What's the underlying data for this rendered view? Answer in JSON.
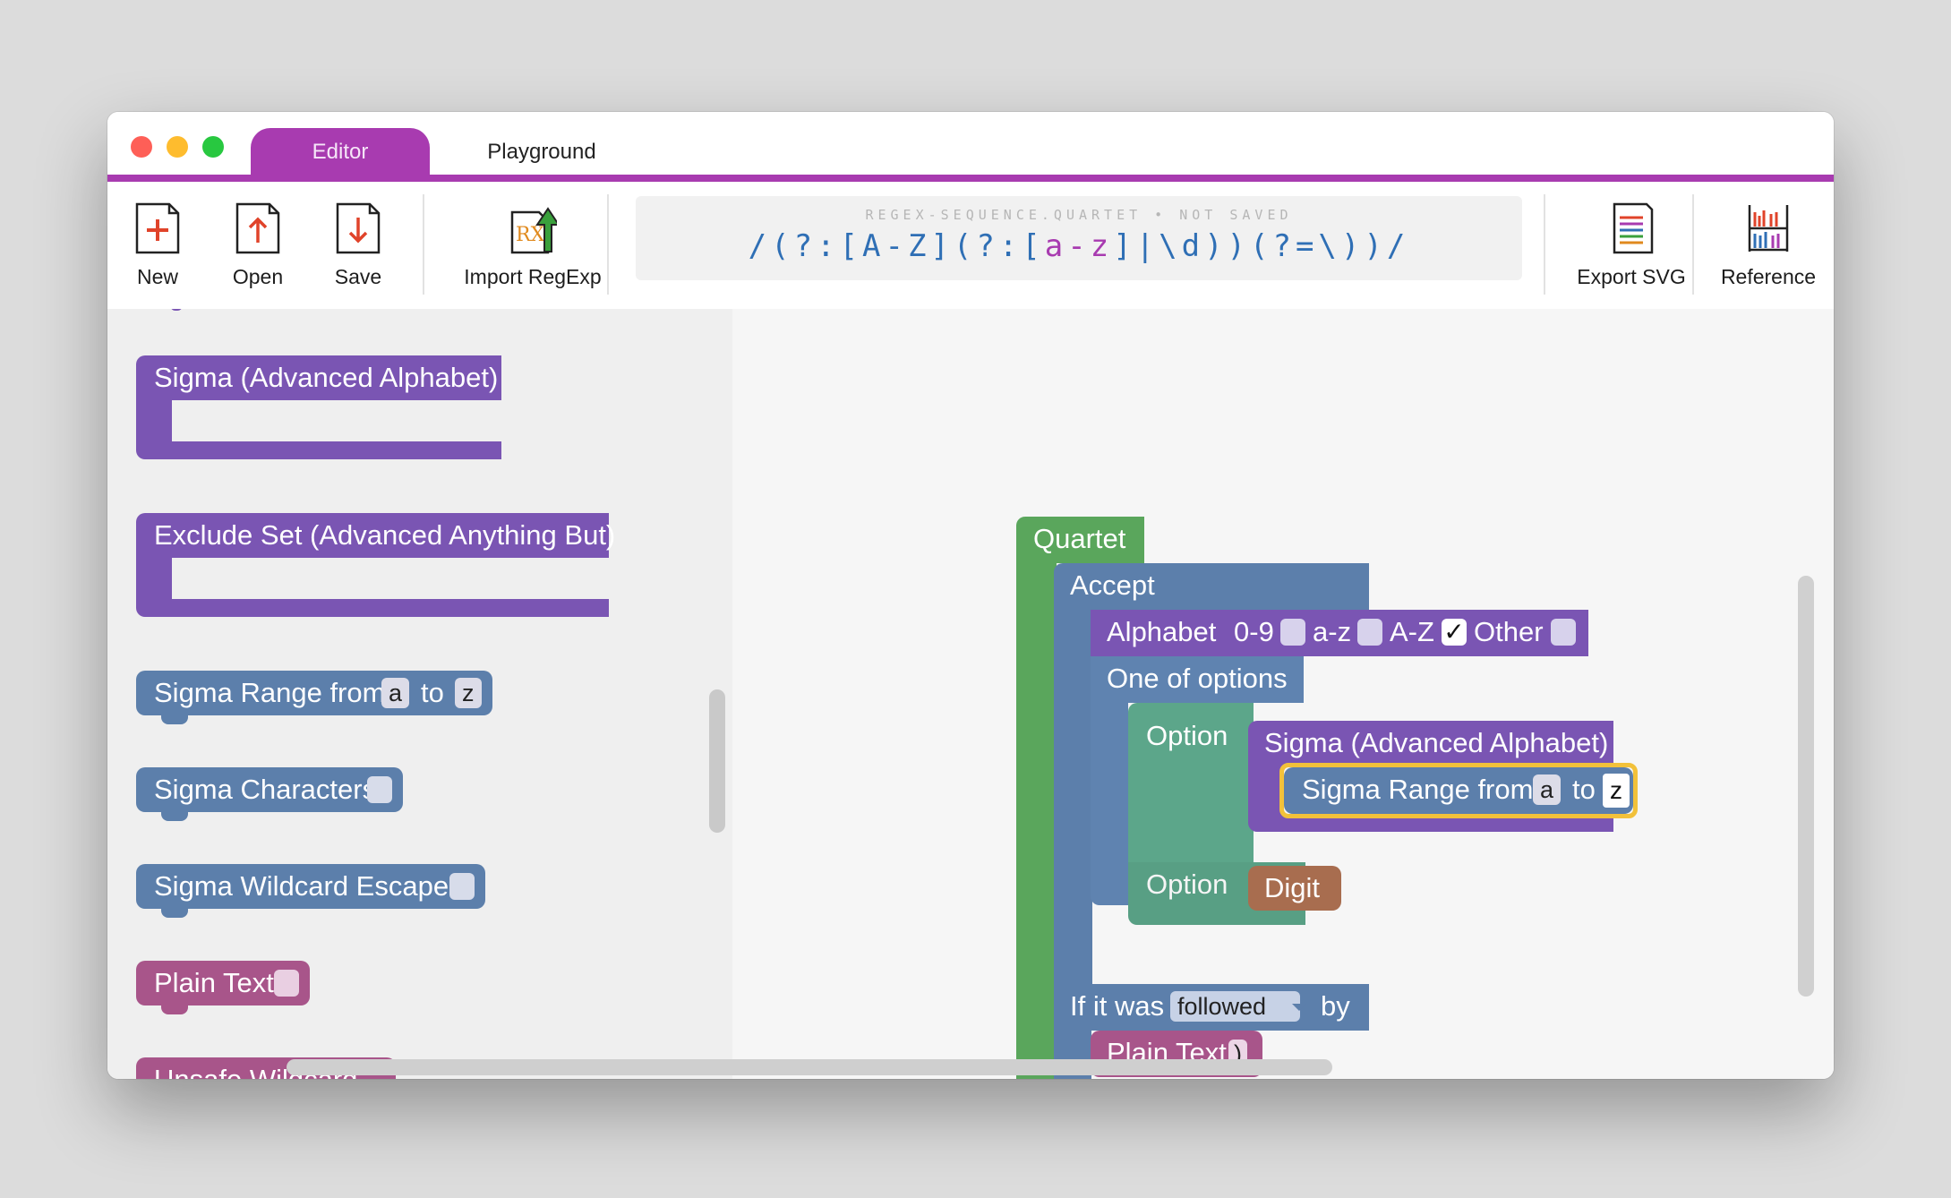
{
  "tabs": {
    "editor": "Editor",
    "playground": "Playground"
  },
  "toolbar": {
    "new_label": "New",
    "open_label": "Open",
    "save_label": "Save",
    "import_label": "Import RegExp",
    "export_label": "Export SVG",
    "reference_label": "Reference"
  },
  "regex": {
    "filename": "REGEX-SEQUENCE.QUARTET • NOT SAVED",
    "part1": "/(?:[A-Z](?:[",
    "highlight": "a-z",
    "part2": "]|\\d))(?=\\))/"
  },
  "toolbox": {
    "sigma_adv": "Sigma (Advanced Alphabet)",
    "exclude_set": "Exclude Set (Advanced Anything But)",
    "sigma_range_from": "Sigma Range from",
    "sigma_range_a": "a",
    "sigma_range_to": "to",
    "sigma_range_z": "z",
    "sigma_chars": "Sigma Characters",
    "sigma_wildcard": "Sigma Wildcard Escapes",
    "plain_text": "Plain Text",
    "unsafe_wildcard": "Unsafe Wildcard"
  },
  "workspace": {
    "quartet": "Quartet",
    "accept": "Accept",
    "alphabet": "Alphabet",
    "opt_09": "0-9",
    "opt_az": "a-z",
    "opt_AZ": "A-Z",
    "opt_other": "Other",
    "check_mark": "✓",
    "one_of": "One of options",
    "option1": "Option",
    "sigma_adv": "Sigma (Advanced Alphabet)",
    "sigma_range_from": "Sigma Range from",
    "range_a": "a",
    "range_to": "to",
    "range_z": "z",
    "option2": "Option",
    "digit": "Digit",
    "if_it_was": "If it was",
    "followed": "followed",
    "by": "by",
    "plain_text": "Plain Text",
    "plain_text_value": ")"
  },
  "colors": {
    "accent": "#a83bb0",
    "sigma_purple": "#7a55b3",
    "accept_slate": "#5c7fab",
    "quartet_green": "#5aa65c",
    "option_teal": "#5ca68a",
    "plain_rose": "#a8558a",
    "digit_brown": "#a86d4f",
    "selection": "#f2c13a"
  },
  "icons": [
    "new-file-icon",
    "open-file-icon",
    "save-file-icon",
    "import-regexp-icon",
    "export-svg-icon",
    "reference-icon"
  ]
}
